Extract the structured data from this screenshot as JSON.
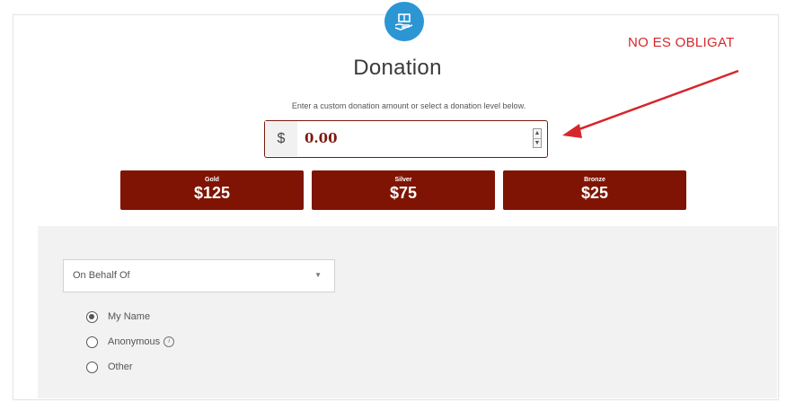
{
  "header": {
    "icon": "hand-donation-icon",
    "title": "Donation",
    "instructions": "Enter a custom donation amount or select a donation level below."
  },
  "amount": {
    "currency_symbol": "$",
    "value": "0.00"
  },
  "levels": [
    {
      "name": "Gold",
      "amount": "$125"
    },
    {
      "name": "Silver",
      "amount": "$75"
    },
    {
      "name": "Bronze",
      "amount": "$25"
    }
  ],
  "on_behalf": {
    "selected": "On Behalf Of",
    "options": [
      {
        "label": "My Name",
        "checked": true
      },
      {
        "label": "Anonymous",
        "checked": false
      },
      {
        "label": "Other",
        "checked": false
      }
    ]
  },
  "annotation": {
    "text": "NO ES OBLIGAT",
    "color": "#d6262b"
  },
  "colors": {
    "accent": "#7f1404",
    "icon_blue": "#2b96d3"
  }
}
